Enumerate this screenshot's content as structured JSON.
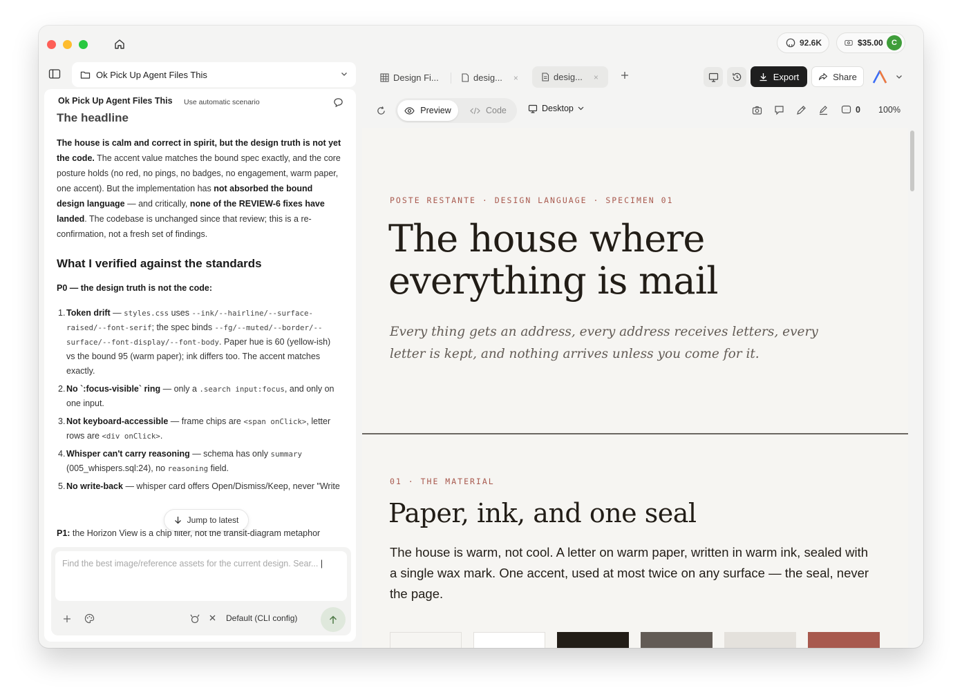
{
  "titlebar": {
    "github_stars": "92.6K",
    "credits": "$35.00",
    "avatar_letter": "C"
  },
  "left": {
    "project_title": "Ok Pick Up Agent Files This",
    "chat_header": {
      "title": "Ok Pick Up Agent Files This",
      "scenario": "Use automatic scenario"
    },
    "message": {
      "headline": "The headline",
      "intro_bold1": "The house is calm and correct in spirit, but the design truth is not yet the code.",
      "intro_text1": " The accent value matches the bound spec exactly, and the core posture holds (no red, no pings, no badges, no engagement, warm paper, one accent). But the implementation has ",
      "intro_bold2": "not absorbed the bound design language",
      "intro_text2": " — and critically, ",
      "intro_bold3": "none of the REVIEW-6 fixes have landed",
      "intro_text3": ". The codebase is unchanged since that review; this is a re-confirmation, not a fresh set of findings.",
      "section_title": "What I verified against the standards",
      "p0_label": "P0 — the design truth is not the code:",
      "issues": [
        {
          "num": "1.",
          "bold": "Token drift",
          "t1": " — ",
          "c1": "styles.css",
          "t2": " uses ",
          "c2": "--ink/--hairline/--surface-raised/--font-serif",
          "t3": "; the spec binds ",
          "c3": "--fg/--muted/--border/--surface/--font-display/--font-body",
          "t4": ". Paper hue is 60 (yellow-ish) vs the bound 95 (warm paper); ink differs too. The accent matches exactly."
        },
        {
          "num": "2.",
          "bold": "No `:focus-visible` ring",
          "t1": " — only a ",
          "c1": ".search input:focus",
          "t2": ", and only on one input."
        },
        {
          "num": "3.",
          "bold": "Not keyboard-accessible",
          "t1": " — frame chips are ",
          "c1": "<span onClick>",
          "t2": ", letter rows are ",
          "c2": "<div onClick>",
          "t3": "."
        },
        {
          "num": "4.",
          "bold": "Whisper can't carry reasoning",
          "t1": " — schema has only ",
          "c1": "summary",
          "t2": " (005_whispers.sql:24), no ",
          "c2": "reasoning",
          "t3": " field."
        },
        {
          "num": "5.",
          "bold": "No write-back",
          "t1": " — whisper card offers Open/Dismiss/Keep, never \"Write back\" (the stron"
        }
      ],
      "p1_label": "P1:",
      "p1_text": " the Horizon View is a chip filter, not the transit-diagram metaphor"
    },
    "jump_label": "Jump to latest",
    "composer": {
      "placeholder": "Find the best image/reference assets for the current design. Sear...",
      "model": "Default (CLI config)"
    }
  },
  "tabs": [
    {
      "label": "Design Fi...",
      "icon": "grid-icon"
    },
    {
      "label": "desig...",
      "icon": "file-icon"
    },
    {
      "label": "desig...",
      "icon": "doc-icon"
    }
  ],
  "toolbar": {
    "export_label": "Export",
    "share_label": "Share",
    "preview_label": "Preview",
    "code_label": "Code",
    "device_label": "Desktop",
    "comment_count": "0",
    "zoom": "100%"
  },
  "canvas": {
    "eyebrow": "POSTE RESTANTE · DESIGN LANGUAGE · SPECIMEN 01",
    "hero_title": "The house where everything is mail",
    "hero_sub": "Every thing gets an address, every address receives letters, every letter is kept, and nothing arrives unless you come for it.",
    "section_eyebrow": "01 · THE MATERIAL",
    "section_title": "Paper, ink, and one seal",
    "section_body": "The house is warm, not cool. A letter on warm paper, written in warm ink, sealed with a single wax mark. One accent, used at most twice on any surface — the seal, never the page.",
    "swatches": [
      "#f6f5f2",
      "#ffffff",
      "#221d17",
      "#625b55",
      "#e4e1dc",
      "#a8594e"
    ]
  },
  "colors": {
    "accent": "#a8594e",
    "ink": "#221d17",
    "send_button": "#dfe8dc",
    "avatar": "#3f9d3a"
  }
}
